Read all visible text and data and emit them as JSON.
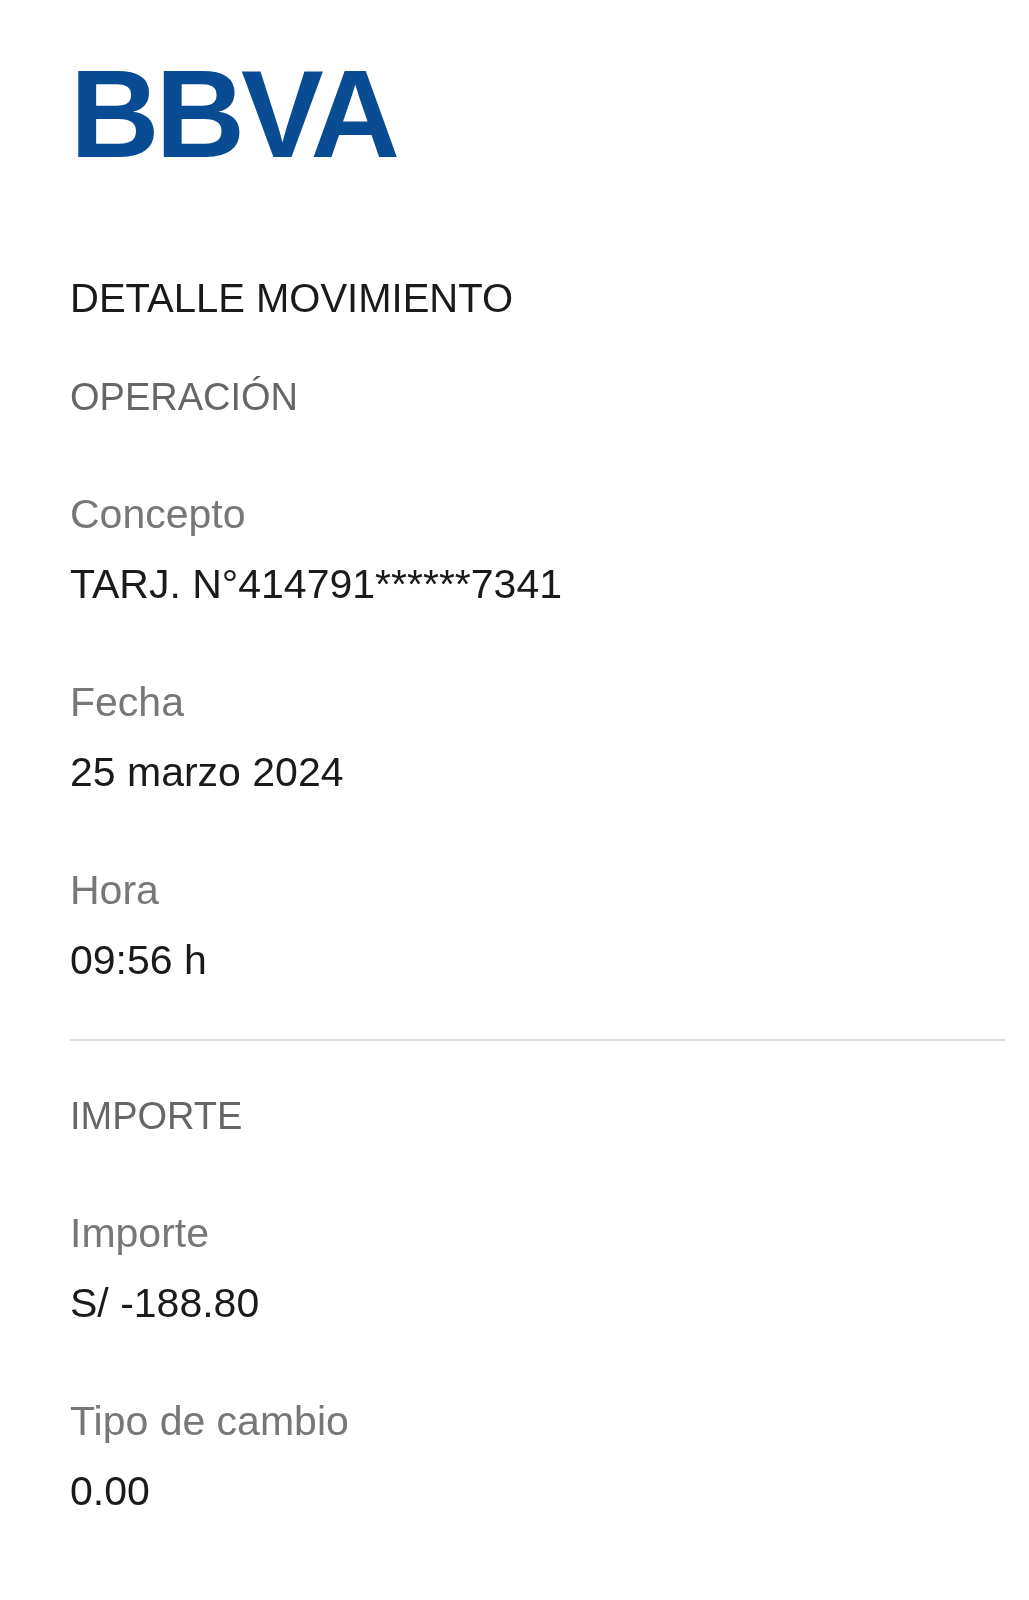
{
  "logo": "BBVA",
  "title": "DETALLE MOVIMIENTO",
  "sections": [
    {
      "heading": "OPERACIÓN",
      "fields": [
        {
          "label": "Concepto",
          "value": "TARJ. N°414791******7341"
        },
        {
          "label": "Fecha",
          "value": "25 marzo 2024"
        },
        {
          "label": "Hora",
          "value": "09:56 h"
        }
      ]
    },
    {
      "heading": "IMPORTE",
      "fields": [
        {
          "label": "Importe",
          "value": "S/ -188.80"
        },
        {
          "label": "Tipo de cambio",
          "value": "0.00"
        }
      ]
    }
  ]
}
